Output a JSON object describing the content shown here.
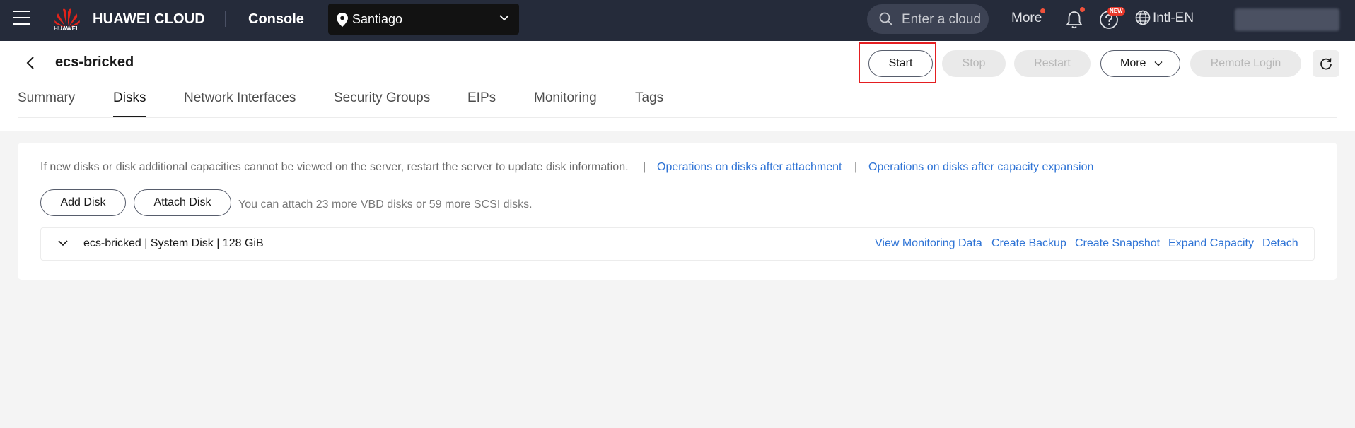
{
  "topbar": {
    "logo_text": "HUAWEI",
    "brand": "HUAWEI CLOUD",
    "console": "Console",
    "region": "Santiago",
    "search_placeholder": "Enter a cloud service name",
    "more": "More",
    "new_badge": "NEW",
    "language": "Intl-EN",
    "colors": {
      "bg": "#252b3a",
      "region_bg": "#121212",
      "notify_dot": "#f0513b"
    }
  },
  "header": {
    "title": "ecs-bricked",
    "actions": {
      "start": "Start",
      "stop": "Stop",
      "restart": "Restart",
      "more": "More",
      "remote_login": "Remote Login"
    }
  },
  "tabs": [
    {
      "label": "Summary",
      "active": false
    },
    {
      "label": "Disks",
      "active": true
    },
    {
      "label": "Network Interfaces",
      "active": false
    },
    {
      "label": "Security Groups",
      "active": false
    },
    {
      "label": "EIPs",
      "active": false
    },
    {
      "label": "Monitoring",
      "active": false
    },
    {
      "label": "Tags",
      "active": false
    }
  ],
  "disks": {
    "info": "If new disks or disk additional capacities cannot be viewed on the server, restart the server to update disk information.",
    "separator": "|",
    "link_attachment": "Operations on disks after attachment",
    "link_expansion": "Operations on disks after capacity expansion",
    "add_disk": "Add Disk",
    "attach_disk": "Attach Disk",
    "attach_note": "You can attach 23 more VBD disks or 59 more SCSI disks.",
    "row": {
      "name": "ecs-bricked | System Disk | 128 GiB",
      "actions": [
        "View Monitoring Data",
        "Create Backup",
        "Create Snapshot",
        "Expand Capacity",
        "Detach"
      ]
    },
    "link_color": "#2e73d5"
  }
}
